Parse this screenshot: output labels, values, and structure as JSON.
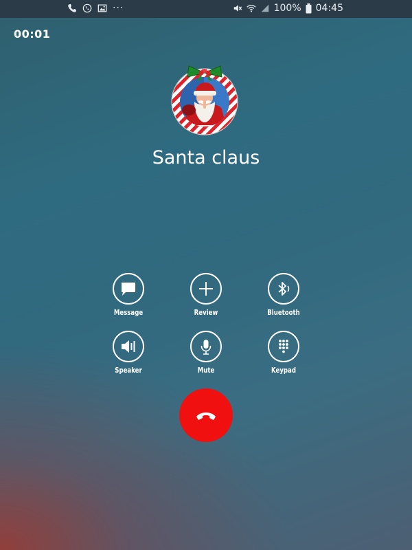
{
  "status_bar": {
    "left_icons": [
      "phone-icon",
      "phone-sync-icon",
      "image-icon",
      "more-dots-icon"
    ],
    "more_dots": "···",
    "battery_level": "100%",
    "time": "04:45"
  },
  "call": {
    "timer": "00:01",
    "caller_name": "Santa claus"
  },
  "actions": [
    {
      "label": "Message",
      "icon": "message-icon"
    },
    {
      "label": "Review",
      "icon": "plus-icon"
    },
    {
      "label": "Bluetooth",
      "icon": "bluetooth-icon"
    },
    {
      "label": "Speaker",
      "icon": "speaker-icon"
    },
    {
      "label": "Mute",
      "icon": "microphone-icon"
    },
    {
      "label": "Keypad",
      "icon": "keypad-icon"
    }
  ],
  "end_call": {
    "icon": "end-call-icon"
  },
  "colors": {
    "end_call": "#f01010",
    "status_bar": "#2b3c48",
    "background_teal": "#31697f"
  }
}
